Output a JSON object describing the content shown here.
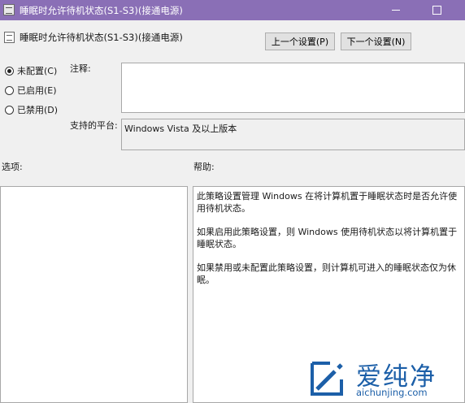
{
  "window": {
    "title": "睡眠时允许待机状态(S1-S3)(接通电源)"
  },
  "header": {
    "title": "睡眠时允许待机状态(S1-S3)(接通电源)",
    "prev_button": "上一个设置(P)",
    "next_button": "下一个设置(N)"
  },
  "state_options": [
    {
      "label": "未配置(C)",
      "checked": true
    },
    {
      "label": "已启用(E)",
      "checked": false
    },
    {
      "label": "已禁用(D)",
      "checked": false
    }
  ],
  "comment": {
    "label": "注释:",
    "value": ""
  },
  "platform": {
    "label": "支持的平台:",
    "value": "Windows Vista 及以上版本"
  },
  "options": {
    "label": "选项:"
  },
  "help": {
    "label": "帮助:",
    "paragraphs": [
      "此策略设置管理 Windows 在将计算机置于睡眠状态时是否允许使用待机状态。",
      "如果启用此策略设置，则 Windows 使用待机状态以将计算机置于睡眠状态。",
      "如果禁用或未配置此策略设置，则计算机可进入的睡眠状态仅为休眠。"
    ]
  },
  "watermark": {
    "brand": "爱纯净",
    "url": "aichunjing.com"
  },
  "colors": {
    "titlebar": "#8a6fb6",
    "watermark": "#1c5fa8"
  }
}
